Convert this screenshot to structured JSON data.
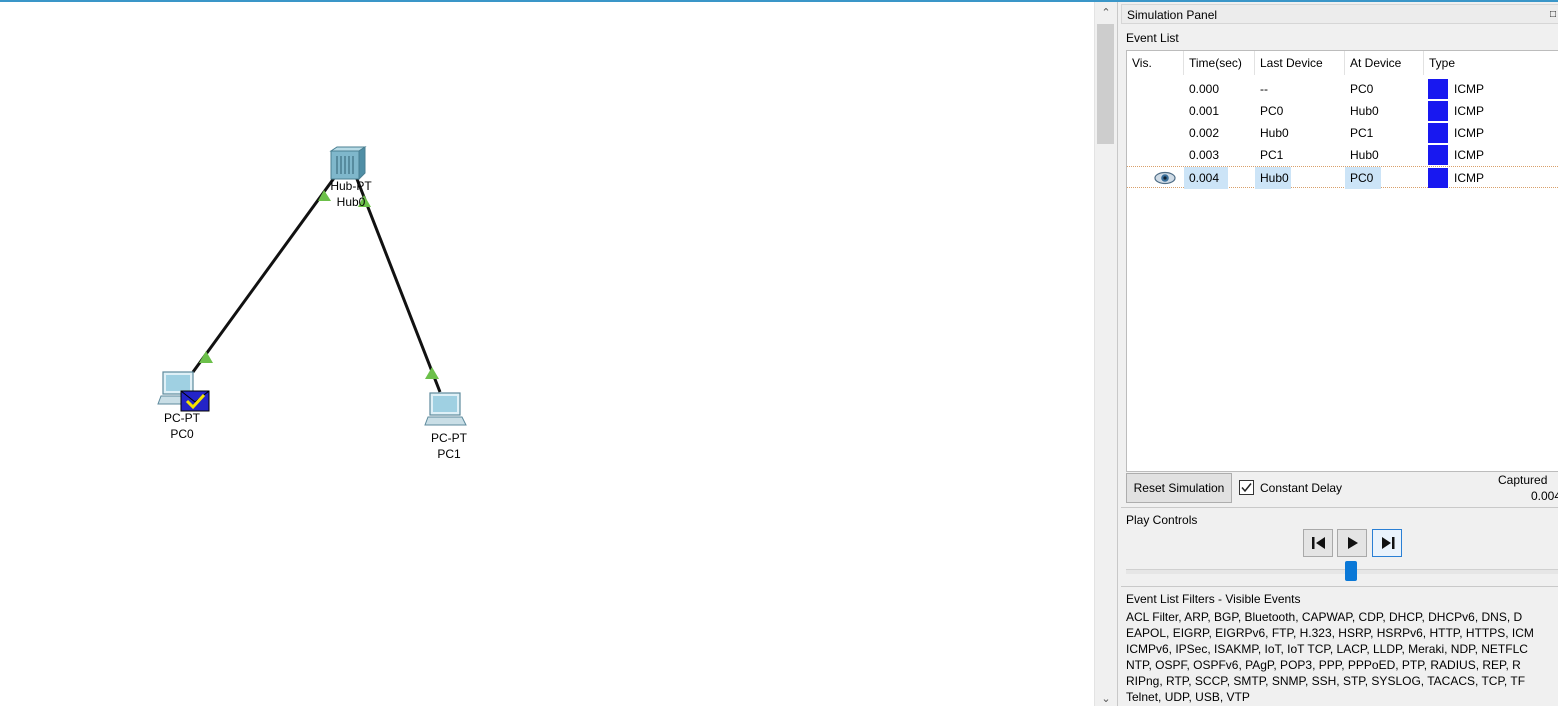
{
  "workspace": {
    "devices": [
      {
        "id": "hub0",
        "model": "Hub-PT",
        "name": "Hub0",
        "icon": "hub-icon"
      },
      {
        "id": "pc0",
        "model": "PC-PT",
        "name": "PC0",
        "icon": "pc-icon",
        "pdu": "envelope-check-icon"
      },
      {
        "id": "pc1",
        "model": "PC-PT",
        "name": "PC1",
        "icon": "pc-icon"
      }
    ],
    "links": [
      {
        "from": "Hub0",
        "to": "PC0",
        "status": "up",
        "color": "#6ab04c"
      },
      {
        "from": "Hub0",
        "to": "PC1",
        "status": "up",
        "color": "#6ab04c"
      }
    ]
  },
  "panel": {
    "title": "Simulation Panel",
    "event_list_label": "Event List",
    "columns": [
      "Vis.",
      "Time(sec)",
      "Last Device",
      "At Device",
      "Type"
    ],
    "events": [
      {
        "vis": "",
        "time": "0.000",
        "last": "--",
        "at": "PC0",
        "type": "ICMP",
        "color": "#1818f0"
      },
      {
        "vis": "",
        "time": "0.001",
        "last": "PC0",
        "at": "Hub0",
        "type": "ICMP",
        "color": "#1818f0"
      },
      {
        "vis": "",
        "time": "0.002",
        "last": "Hub0",
        "at": "PC1",
        "type": "ICMP",
        "color": "#1818f0"
      },
      {
        "vis": "",
        "time": "0.003",
        "last": "PC1",
        "at": "Hub0",
        "type": "ICMP",
        "color": "#1818f0"
      },
      {
        "vis": "eye-icon",
        "time": "0.004",
        "last": "Hub0",
        "at": "PC0",
        "type": "ICMP",
        "color": "#1818f0",
        "selected": true
      }
    ],
    "reset_label": "Reset Simulation",
    "constant_delay_label": "Constant Delay",
    "constant_delay_checked": true,
    "captured_label": "Captured",
    "captured_value": "0.004",
    "play_controls_label": "Play Controls",
    "play_buttons": [
      "step-back-icon",
      "play-icon",
      "step-forward-icon"
    ],
    "slider_position": 0.52,
    "filters_label": "Event List Filters - Visible Events",
    "filters_lines": [
      "ACL Filter, ARP, BGP, Bluetooth, CAPWAP, CDP, DHCP, DHCPv6, DNS, D",
      "EAPOL, EIGRP, EIGRPv6, FTP, H.323, HSRP, HSRPv6, HTTP, HTTPS, ICM",
      "ICMPv6, IPSec, ISAKMP, IoT, IoT TCP, LACP, LLDP, Meraki, NDP, NETFLC",
      "NTP, OSPF, OSPFv6, PAgP, POP3, PPP, PPPoED, PTP, RADIUS, REP, R",
      "RIPng, RTP, SCCP, SMTP, SNMP, SSH, STP, SYSLOG, TACACS, TCP, TF",
      "Telnet, UDP, USB, VTP"
    ]
  }
}
